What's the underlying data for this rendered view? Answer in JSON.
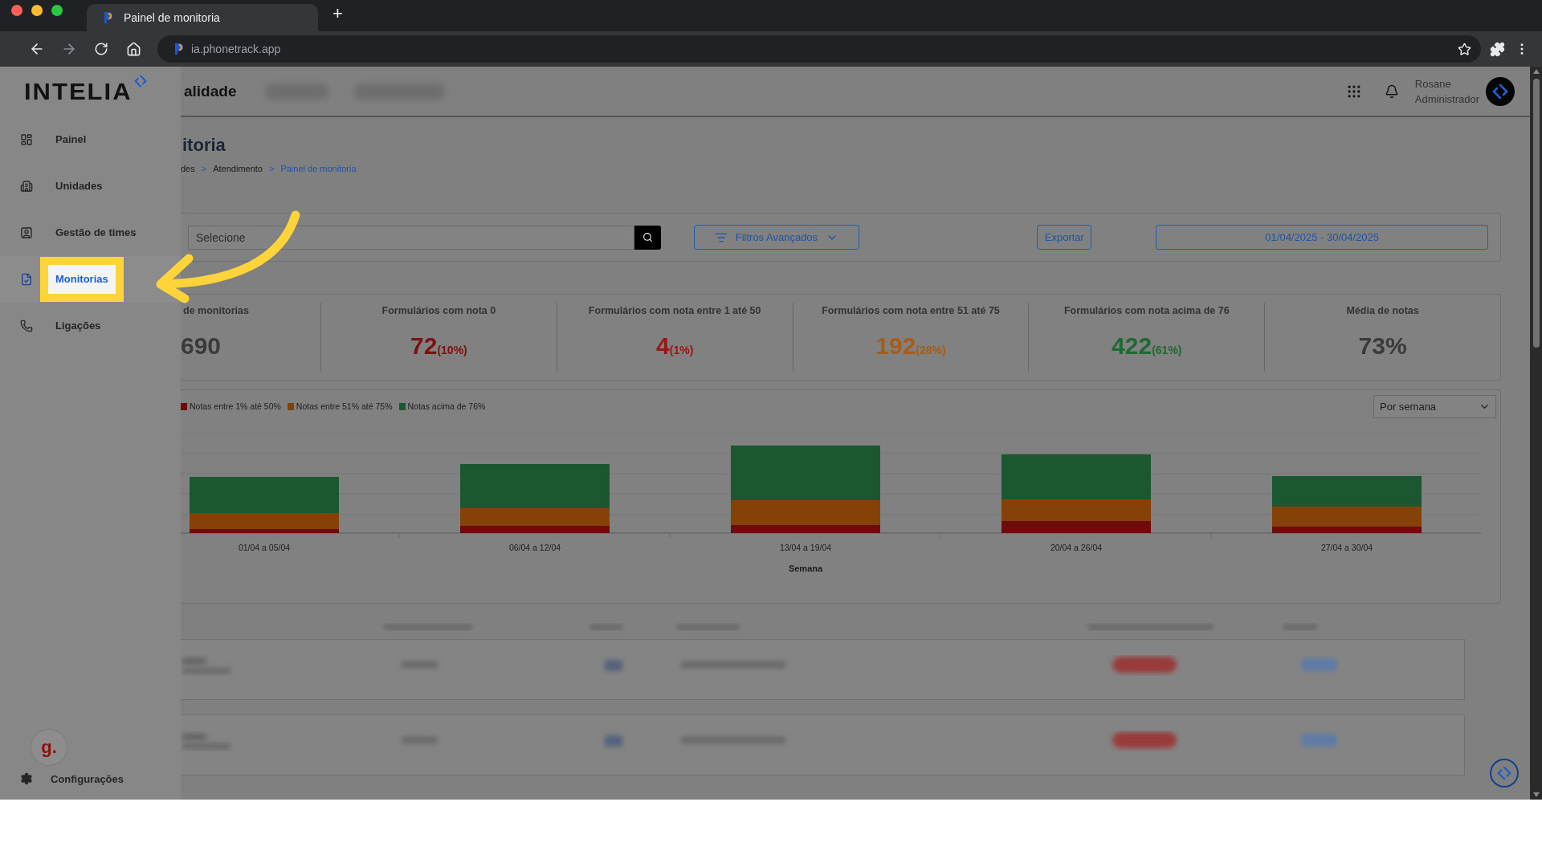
{
  "browser": {
    "tab_title": "Painel de monitoria",
    "new_tab": "+",
    "url": "ia.phonetrack.app"
  },
  "sidebar": {
    "logo": "INTELIA",
    "items": [
      {
        "label": "Painel",
        "selected": false
      },
      {
        "label": "Unidades",
        "selected": false
      },
      {
        "label": "Gestão de times",
        "selected": false
      },
      {
        "label": "Monitorias",
        "selected": true
      },
      {
        "label": "Ligações",
        "selected": false
      }
    ],
    "avatar": "g.",
    "settings": "Configurações"
  },
  "header": {
    "title": "alidade",
    "user_name": "Rosane",
    "user_role": "Administrador"
  },
  "page": {
    "title": "itoria",
    "separator": ">",
    "breadcrumb": [
      {
        "label": "des",
        "current": false
      },
      {
        "label": "Atendimento",
        "current": false
      },
      {
        "label": "Painel de monitoria",
        "current": true
      }
    ]
  },
  "filters": {
    "search_placeholder": "Selecione",
    "advanced": "Filtros Avançados",
    "export": "Exportar",
    "date_range": "01/04/2025 - 30/04/2025"
  },
  "stats": [
    {
      "label": "de monitorias",
      "value": "690",
      "color": "#3a3a3a"
    },
    {
      "label": "Formulários com nota 0",
      "value": "72",
      "percent": "(10%)",
      "color": "#7a1212"
    },
    {
      "label": "Formulários com nota entre 1 até 50",
      "value": "4",
      "percent": "(1%)",
      "color": "#9c1616"
    },
    {
      "label": "Formulários com nota entre 51 até 75",
      "value": "192",
      "percent": "(28%)",
      "color": "#a85c16"
    },
    {
      "label": "Formulários com nota acima de 76",
      "value": "422",
      "percent": "(61%)",
      "color": "#1d6a32"
    },
    {
      "label": "Média de notas",
      "value": "73%",
      "color": "#3a3a3a"
    }
  ],
  "chart": {
    "legend": [
      {
        "label": "Notas entre 1% até 50%",
        "color": "#6e0b0b"
      },
      {
        "label": "Notas entre 51% até 75%",
        "color": "#844209"
      },
      {
        "label": "Notas acima de 76%",
        "color": "#1b5730"
      }
    ],
    "period_select": "Por semana",
    "x_labels": [
      "01/04 a 05/04",
      "06/04 a 12/04",
      "13/04 a 19/04",
      "20/04 a 26/04",
      "27/04 a 30/04"
    ],
    "xlabel": "Semana"
  }
}
